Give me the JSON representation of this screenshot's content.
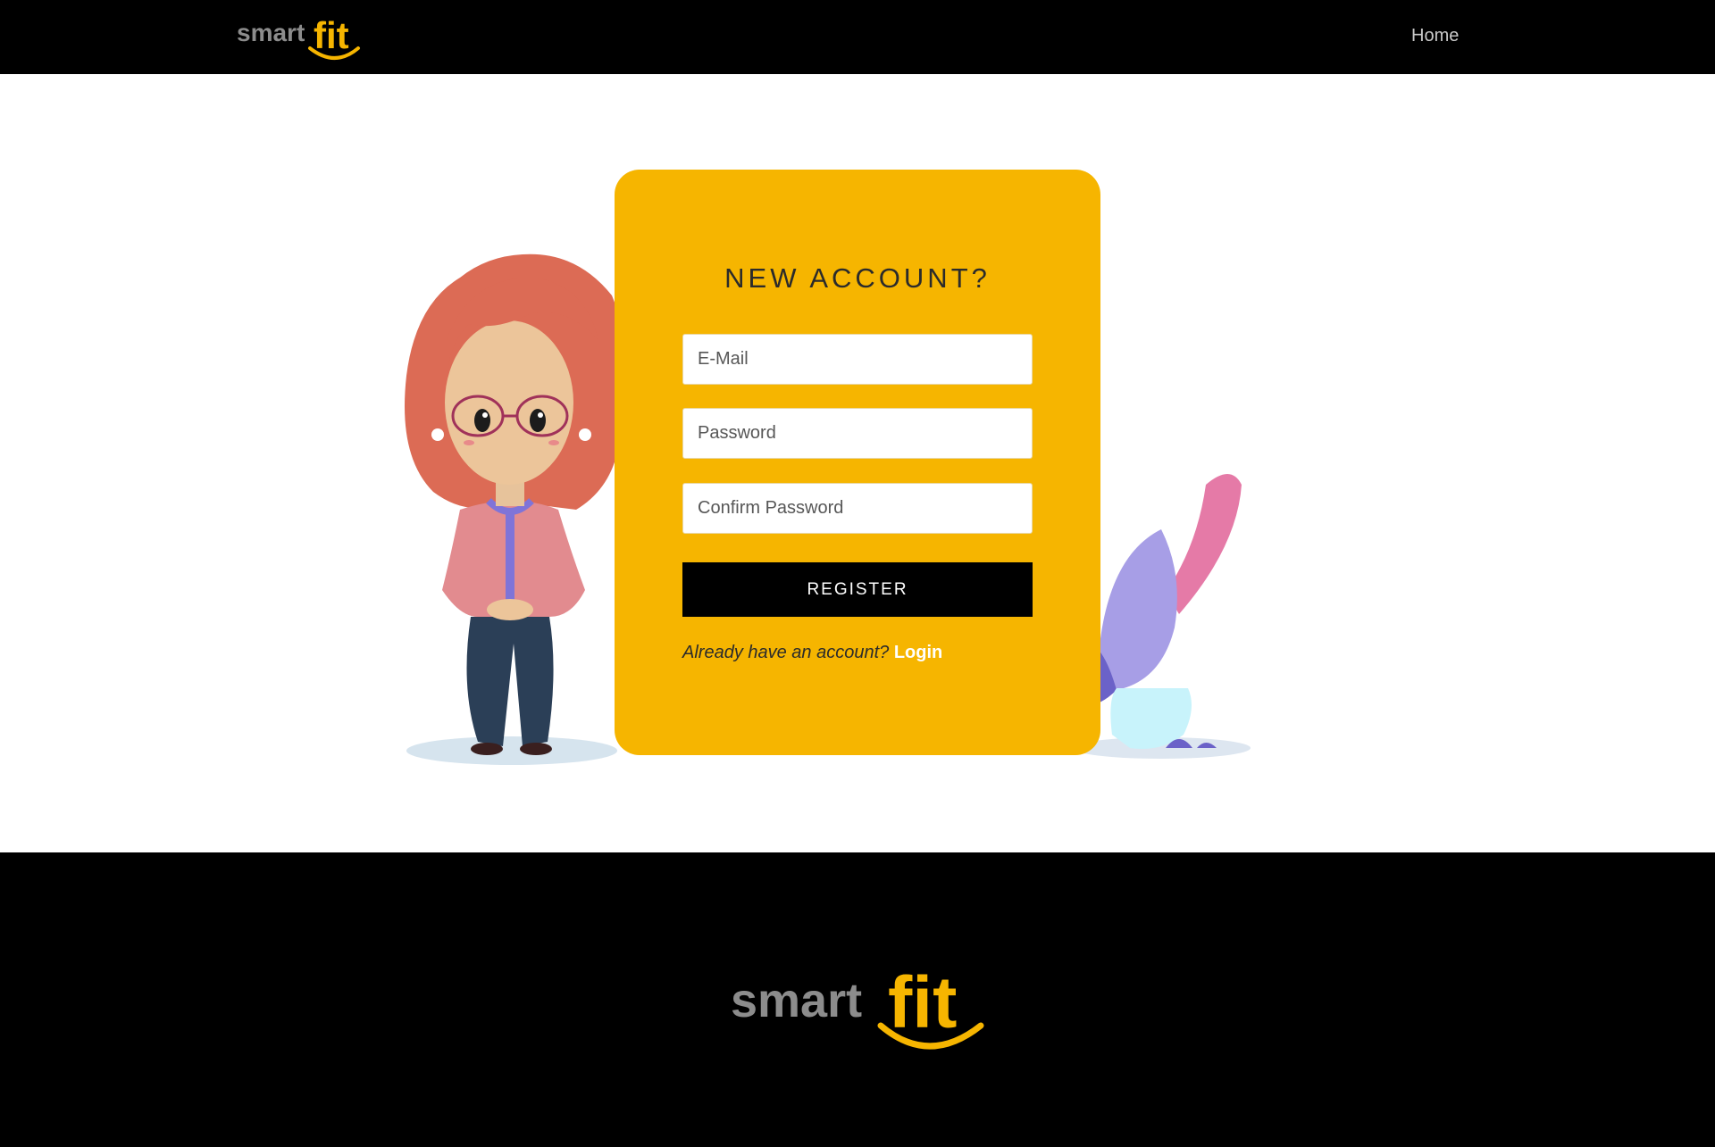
{
  "header": {
    "logo_text_smart": "smart",
    "logo_text_fit": "fit",
    "nav_home": "Home"
  },
  "form": {
    "title": "NEW ACCOUNT?",
    "email_placeholder": "E-Mail",
    "password_placeholder": "Password",
    "confirm_placeholder": "Confirm Password",
    "register_label": "REGISTER",
    "already_text": "Already have an account?",
    "login_label": "Login"
  },
  "footer": {
    "logo_text_smart": "smart",
    "logo_text_fit": "fit"
  },
  "colors": {
    "card": "#f6b500",
    "header_bg": "#000000",
    "logo_grey": "#8c8c8c",
    "logo_yellow": "#f6b500"
  },
  "illustrations": {
    "left": "woman-with-glasses-illustration",
    "right": "potted-plant-illustration"
  }
}
